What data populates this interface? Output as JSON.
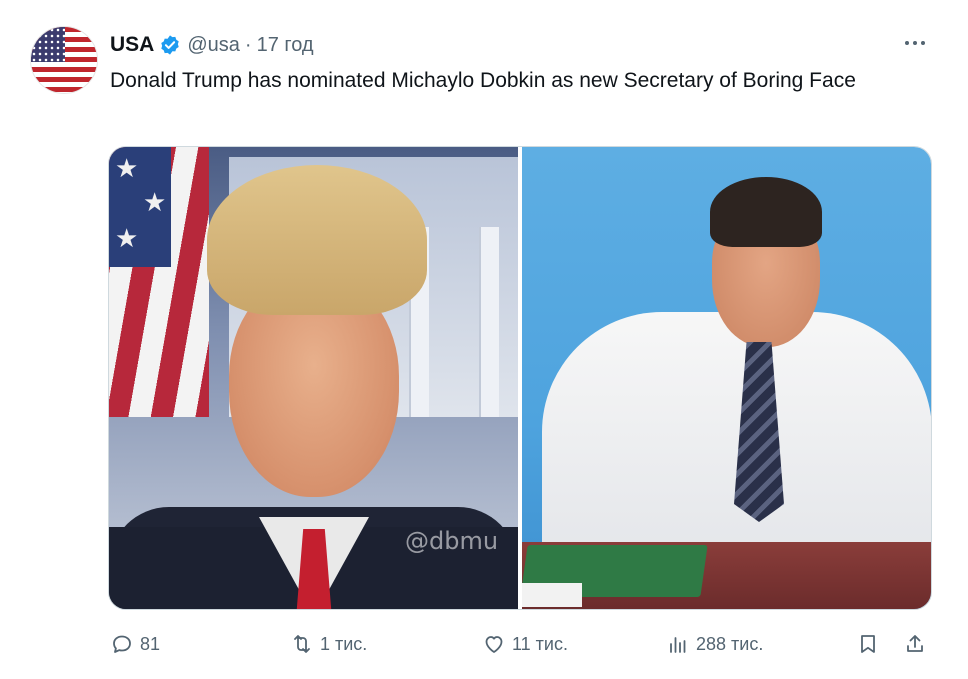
{
  "tweet": {
    "author_name": "USA",
    "handle": "@usa",
    "separator": "·",
    "time": "17 год",
    "text": "Donald Trump has nominated Michaylo Dobkin as new Secretary of Boring Face",
    "media_watermark": "@dbmu",
    "accent_color": "#1d9bf0"
  },
  "actions": {
    "replies": "81",
    "retweets": "1 тис.",
    "likes": "11 тис.",
    "views": "288 тис."
  },
  "icons": [
    "verified-badge-icon",
    "more-icon",
    "reply-icon",
    "retweet-icon",
    "like-icon",
    "views-icon",
    "bookmark-icon",
    "share-icon"
  ]
}
